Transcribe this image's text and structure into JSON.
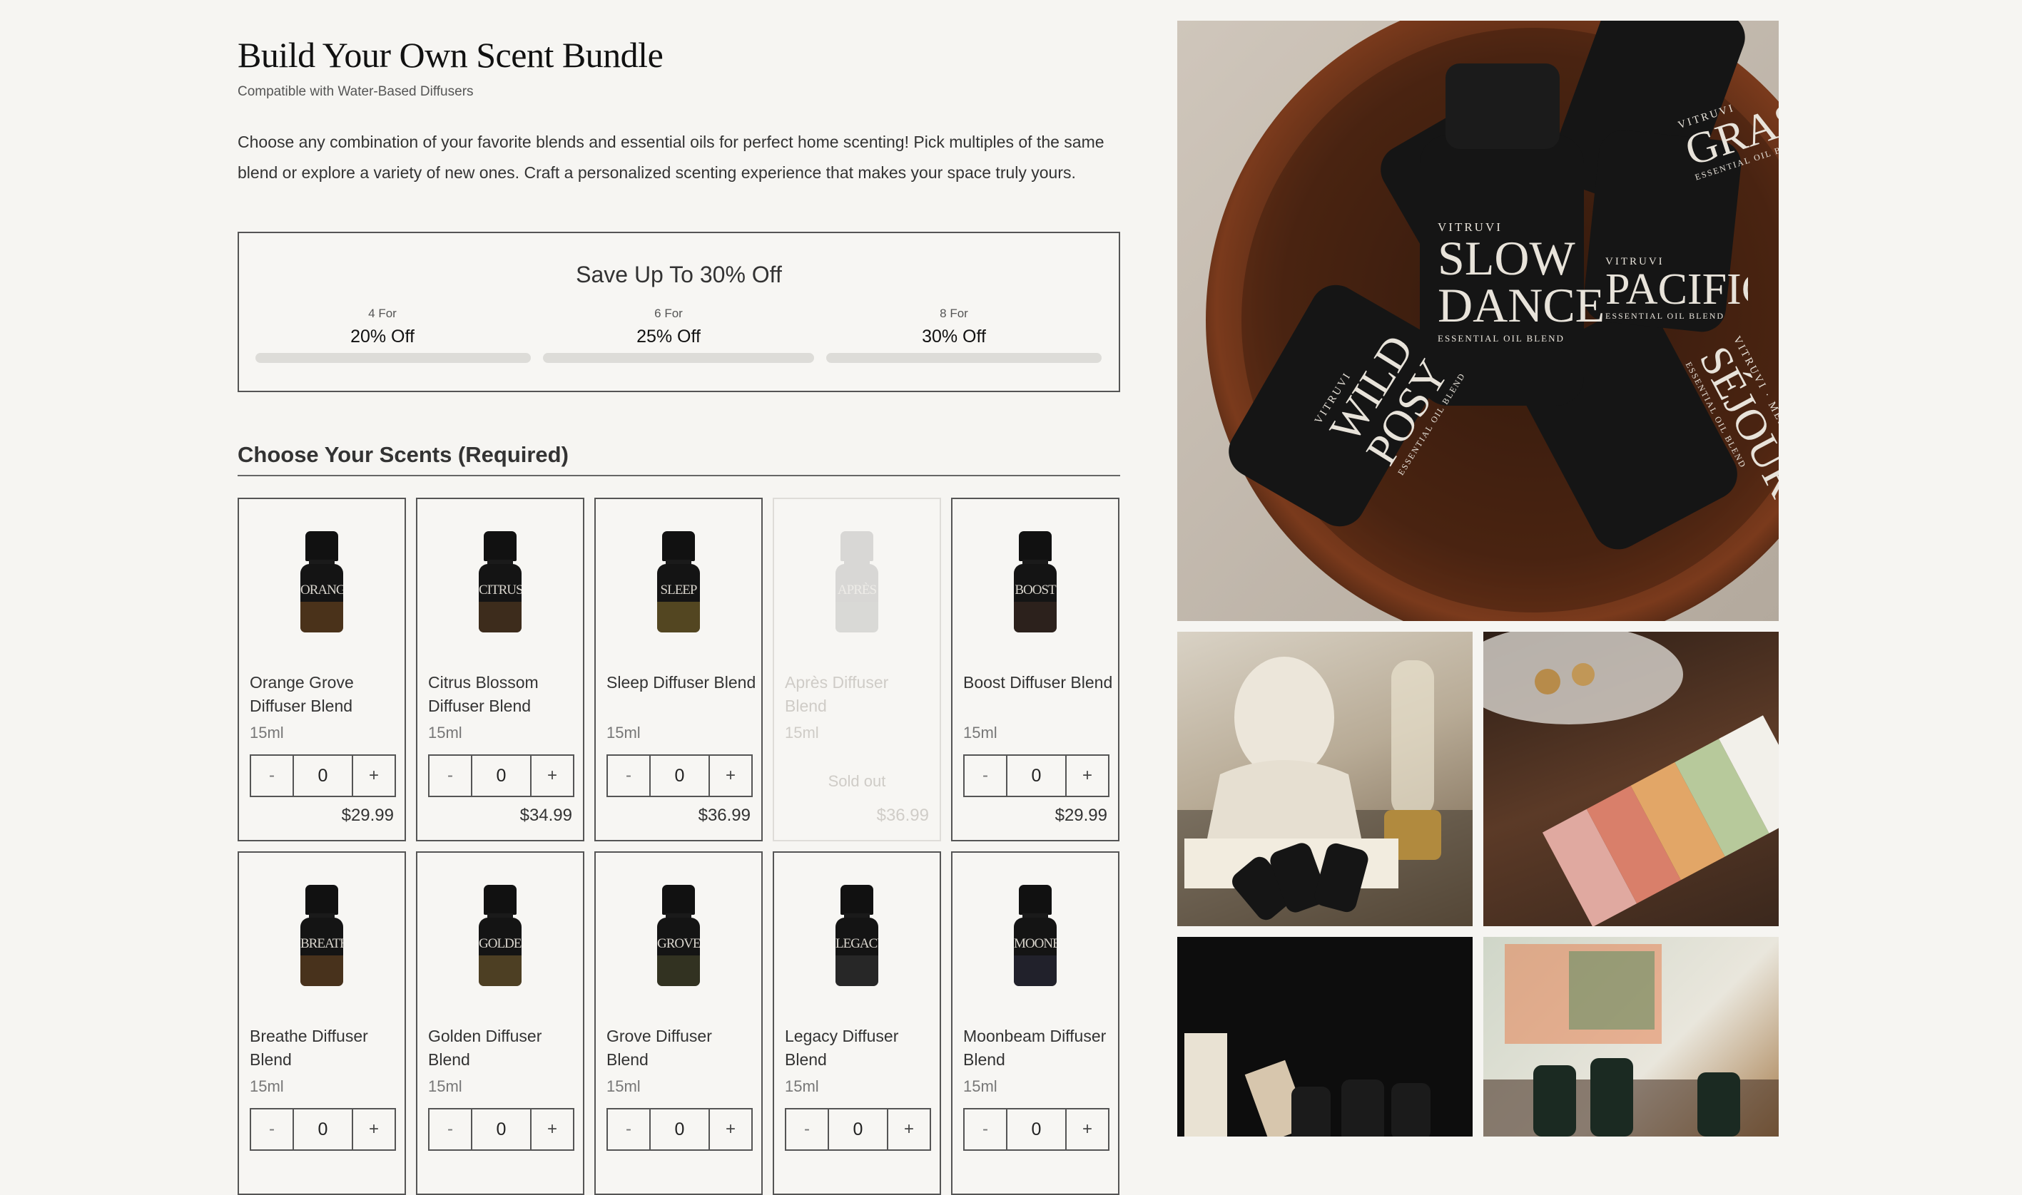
{
  "page": {
    "title": "Build Your Own Scent Bundle",
    "subtitle": "Compatible with Water-Based Diffusers",
    "description": "Choose any combination of your favorite blends and essential oils for perfect home scenting! Pick multiples of the same blend or explore a variety of new ones. Craft a personalized scenting experience that makes your space truly yours."
  },
  "savings": {
    "heading": "Save Up To 30% Off",
    "tiers": [
      {
        "qty": "4 For",
        "discount": "20% Off",
        "progress": 0
      },
      {
        "qty": "6 For",
        "discount": "25% Off",
        "progress": 0
      },
      {
        "qty": "8 For",
        "discount": "30% Off",
        "progress": 0
      }
    ]
  },
  "scents": {
    "heading": "Choose Your Scents (Required)",
    "stepper": {
      "minus": "-",
      "plus": "+"
    },
    "sold_out_label": "Sold out",
    "products": [
      {
        "name": "Orange Grove Diffuser Blend",
        "label": "ORANGE GROVE",
        "size": "15ml",
        "qty": "0",
        "price": "$29.99",
        "sold_out": false,
        "tint": "#b06a25"
      },
      {
        "name": "Citrus Blossom Diffuser Blend",
        "label": "CITRUS BLOSSOM",
        "size": "15ml",
        "qty": "0",
        "price": "$34.99",
        "sold_out": false,
        "tint": "#8a5a2a"
      },
      {
        "name": "Sleep Diffuser Blend",
        "label": "SLEEP",
        "size": "15ml",
        "qty": "0",
        "price": "$36.99",
        "sold_out": false,
        "tint": "#c9a23a"
      },
      {
        "name": "Après Diffuser Blend",
        "label": "APRÈS",
        "size": "15ml",
        "qty": "0",
        "price": "$36.99",
        "sold_out": true,
        "tint": "#999999"
      },
      {
        "name": "Boost Diffuser Blend",
        "label": "BOOST",
        "size": "15ml",
        "qty": "0",
        "price": "$29.99",
        "sold_out": false,
        "tint": "#5a3a2a"
      },
      {
        "name": "Breathe Diffuser Blend",
        "label": "BREATHE",
        "size": "15ml",
        "qty": "0",
        "price": "",
        "sold_out": false,
        "tint": "#a86a2a"
      },
      {
        "name": "Golden Diffuser Blend",
        "label": "GOLDEN",
        "size": "15ml",
        "qty": "0",
        "price": "",
        "sold_out": false,
        "tint": "#b89040"
      },
      {
        "name": "Grove Diffuser Blend",
        "label": "GROVE",
        "size": "15ml",
        "qty": "0",
        "price": "",
        "sold_out": false,
        "tint": "#6a6a3a"
      },
      {
        "name": "Legacy Diffuser Blend",
        "label": "LEGACY",
        "size": "15ml",
        "qty": "0",
        "price": "",
        "sold_out": false,
        "tint": "#4a4a4a"
      },
      {
        "name": "Moonbeam Diffuser Blend",
        "label": "MOONBEAM",
        "size": "15ml",
        "qty": "0",
        "price": "",
        "sold_out": false,
        "tint": "#3a3a55"
      }
    ]
  },
  "gallery": {
    "hero_bottles": [
      {
        "brand": "VITRUVI",
        "name": "SLOW DANCE",
        "sub": "ESSENTIAL OIL BLEND"
      },
      {
        "brand": "VITRUVI",
        "name": "WILD POSY",
        "sub": "ESSENTIAL OIL BLEND"
      },
      {
        "brand": "VITRUVI",
        "name": "GRASS",
        "sub": "ESSENTIAL OIL BLEND"
      },
      {
        "brand": "VITRUVI · MEJURI",
        "name": "SÉJOUR",
        "sub": "ESSENTIAL OIL BLEND"
      },
      {
        "brand": "VITRUVI",
        "name": "PACIFIC",
        "sub": "ESSENTIAL OIL BLEND"
      }
    ]
  }
}
